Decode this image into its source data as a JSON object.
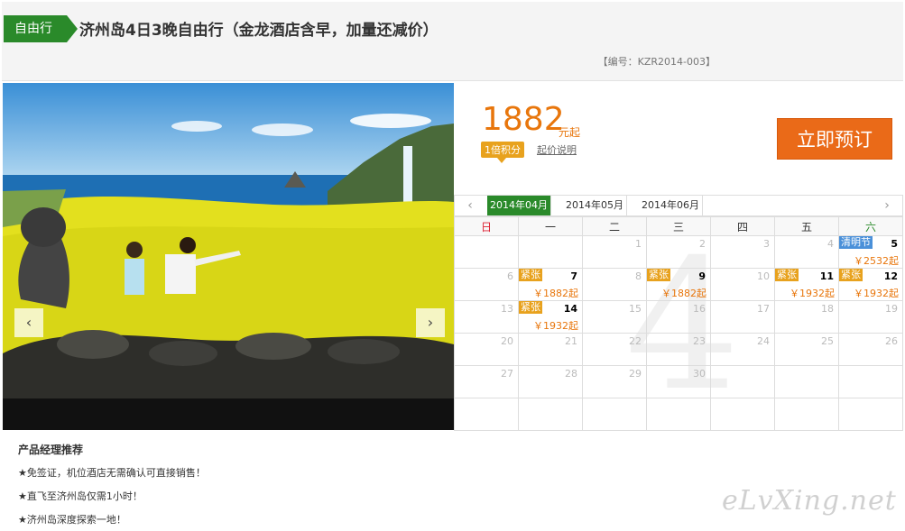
{
  "header": {
    "tag": "自由行",
    "title": "济州岛4日3晚自由行（金龙酒店含早，加量还减价）",
    "code": "【编号：KZR2014-003】"
  },
  "gallery": {
    "prev_icon": "‹",
    "next_icon": "›",
    "slide_count": 4,
    "active_slide": 1
  },
  "pricing": {
    "price": "1882",
    "unit": "元起",
    "points_badge": "1倍积分",
    "price_note": "起价说明",
    "book_button": "立即预订"
  },
  "calendar": {
    "prev_icon": "‹",
    "next_icon": "›",
    "months": [
      "2014年04月",
      "2014年05月",
      "2014年06月"
    ],
    "active_month": 0,
    "weekdays": [
      "日",
      "一",
      "二",
      "三",
      "四",
      "五",
      "六"
    ],
    "big_number": "4",
    "weeks": [
      [
        {
          "d": ""
        },
        {
          "d": ""
        },
        {
          "d": "1"
        },
        {
          "d": "2"
        },
        {
          "d": "3"
        },
        {
          "d": "4"
        },
        {
          "d": "5",
          "avail": true,
          "holiday": "清明节",
          "price": "￥2532起"
        }
      ],
      [
        {
          "d": "6"
        },
        {
          "d": "7",
          "avail": true,
          "badge": "紧张",
          "price": "￥1882起"
        },
        {
          "d": "8"
        },
        {
          "d": "9",
          "avail": true,
          "badge": "紧张",
          "price": "￥1882起"
        },
        {
          "d": "10"
        },
        {
          "d": "11",
          "avail": true,
          "badge": "紧张",
          "price": "￥1932起"
        },
        {
          "d": "12",
          "avail": true,
          "badge": "紧张",
          "price": "￥1932起"
        }
      ],
      [
        {
          "d": "13"
        },
        {
          "d": "14",
          "avail": true,
          "badge": "紧张",
          "price": "￥1932起"
        },
        {
          "d": "15"
        },
        {
          "d": "16"
        },
        {
          "d": "17"
        },
        {
          "d": "18"
        },
        {
          "d": "19"
        }
      ],
      [
        {
          "d": "20"
        },
        {
          "d": "21"
        },
        {
          "d": "22"
        },
        {
          "d": "23"
        },
        {
          "d": "24"
        },
        {
          "d": "25"
        },
        {
          "d": "26"
        }
      ],
      [
        {
          "d": "27"
        },
        {
          "d": "28"
        },
        {
          "d": "29"
        },
        {
          "d": "30"
        },
        {
          "d": ""
        },
        {
          "d": ""
        },
        {
          "d": ""
        }
      ],
      [
        {
          "d": ""
        },
        {
          "d": ""
        },
        {
          "d": ""
        },
        {
          "d": ""
        },
        {
          "d": ""
        },
        {
          "d": ""
        },
        {
          "d": ""
        }
      ]
    ]
  },
  "recommendations": {
    "title": "产品经理推荐",
    "items": [
      "★免签证，机位酒店无需确认可直接销售！",
      "★直飞至济州岛仅需1小时！",
      "★济州岛深度探索一地！"
    ]
  },
  "watermark": "eLvXing.net",
  "colors": {
    "accent_green": "#2a8a2a",
    "price_orange": "#e8760c",
    "book_orange": "#ea6a18",
    "badge_amber": "#e8a21e",
    "holiday_blue": "#4a90d9"
  }
}
